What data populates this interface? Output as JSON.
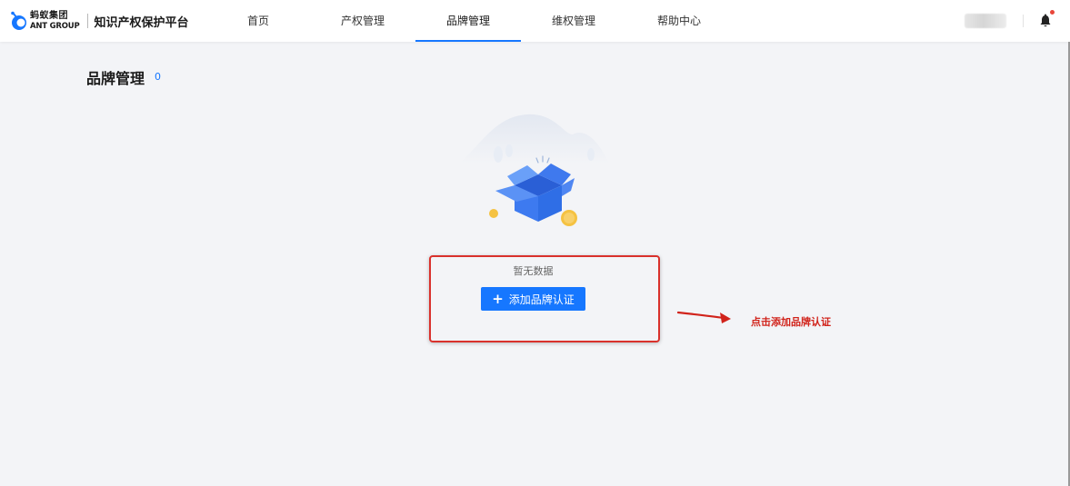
{
  "header": {
    "brand_cn": "蚂蚁集团",
    "brand_en": "ANT GROUP",
    "platform_name": "知识产权保护平台",
    "nav": [
      {
        "label": "首页",
        "active": false
      },
      {
        "label": "产权管理",
        "active": false
      },
      {
        "label": "品牌管理",
        "active": true
      },
      {
        "label": "维权管理",
        "active": false
      },
      {
        "label": "帮助中心",
        "active": false
      }
    ],
    "bell_icon": "bell-icon",
    "has_notification": true
  },
  "main": {
    "page_title": "品牌管理",
    "count": "0",
    "empty_state": {
      "illustration": "empty-box-illustration",
      "text": "暂无数据",
      "add_button_label": "添加品牌认证",
      "add_button_icon": "plus-icon"
    }
  },
  "annotation": {
    "text": "点击添加品牌认证",
    "color": "#d1231b"
  },
  "colors": {
    "accent": "#1677ff",
    "background": "#f3f4f7",
    "highlight": "#d9312c",
    "notification_dot": "#e8463a"
  }
}
